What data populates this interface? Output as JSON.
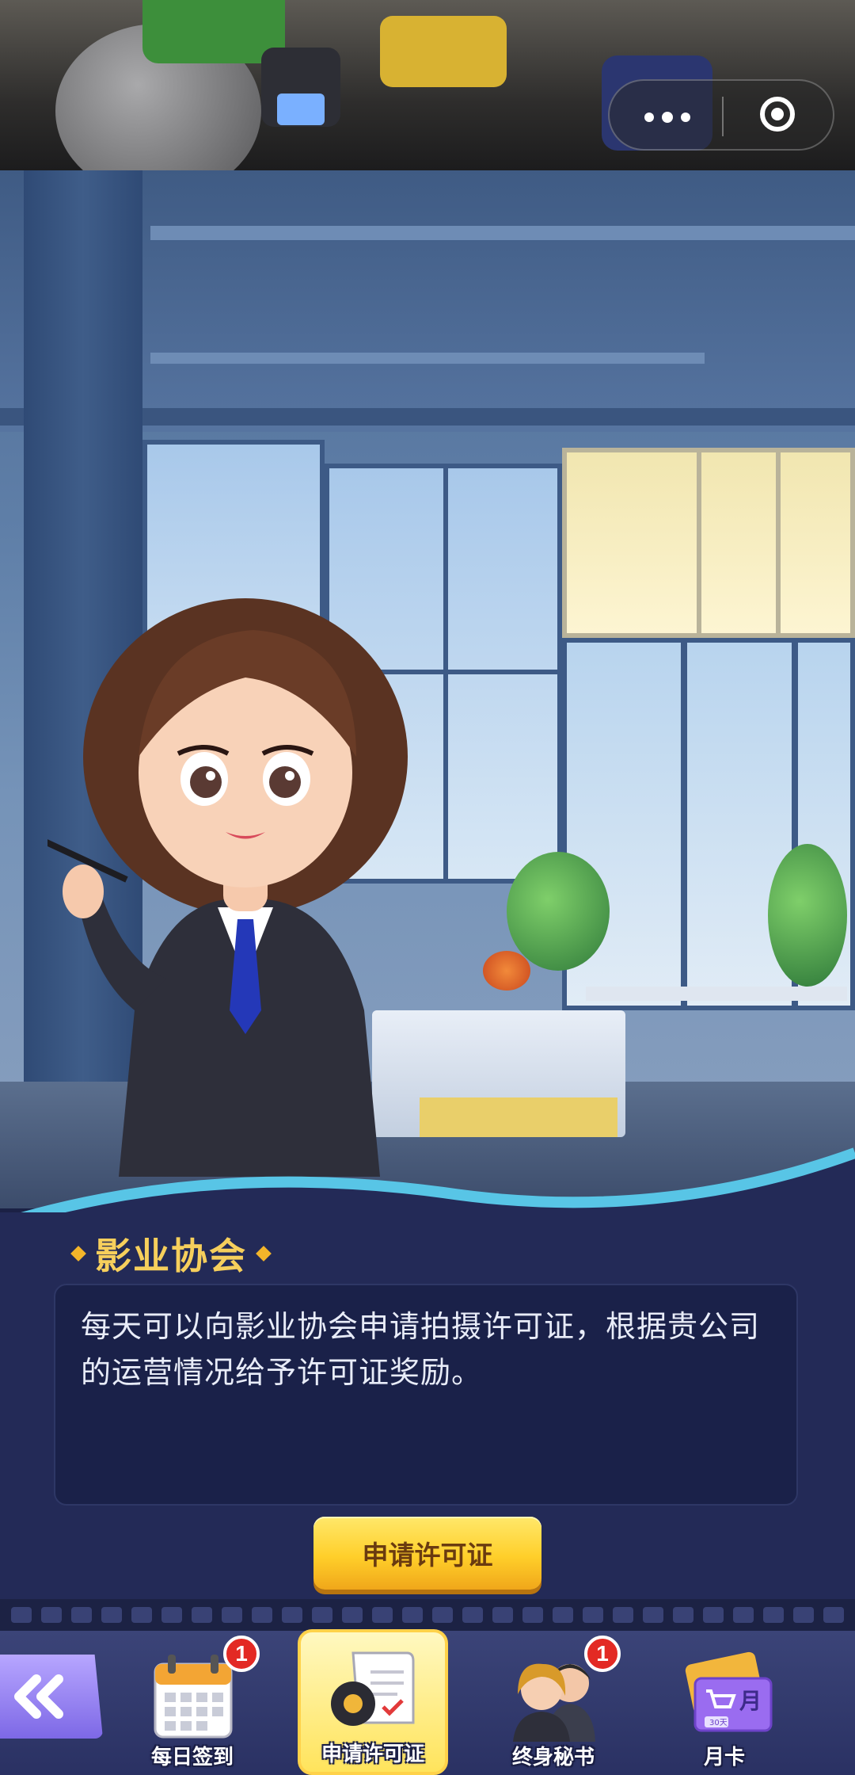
{
  "capsule": {
    "more_icon": "more-dots-icon",
    "close_icon": "close-circle-icon"
  },
  "panel": {
    "title": "影业协会",
    "description": "每天可以向影业协会申请拍摄许可证，根据贵公司的运营情况给予许可证奖励。",
    "apply_button": "申请许可证"
  },
  "nav": {
    "back_icon": "double-chevron-left-icon",
    "items": [
      {
        "label": "每日签到",
        "badge": "1",
        "icon": "calendar-icon"
      },
      {
        "label": "申请许可证",
        "icon": "license-scroll-icon",
        "active": true
      },
      {
        "label": "终身秘书",
        "badge": "1",
        "icon": "secretary-icon"
      },
      {
        "label": "月卡",
        "icon": "monthly-card-icon",
        "card_text": "月",
        "card_small": "30天"
      }
    ]
  },
  "colors": {
    "panel_bg": "#232a57",
    "title_gold": "#f6cf5c",
    "button_yellow": "#ffcf2a",
    "badge_red": "#e32a24",
    "nav_purple": "#7d68e6"
  }
}
